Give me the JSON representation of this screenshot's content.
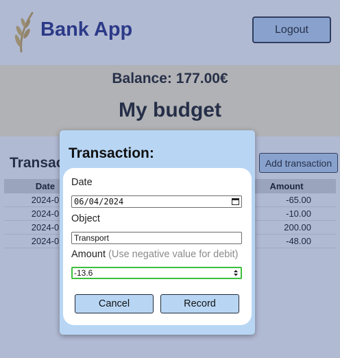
{
  "header": {
    "app_title": "Bank App",
    "logout_label": "Logout",
    "logo_icon": "wheat-logo-icon"
  },
  "summary": {
    "balance": "Balance: 177.00€",
    "budget_title": "My budget"
  },
  "transactions": {
    "title": "Transactions",
    "add_label": "Add transaction",
    "columns": {
      "date": "Date",
      "object": "",
      "amount": "Amount"
    },
    "rows": [
      {
        "date": "2024-0",
        "object": "",
        "amount": "-65.00"
      },
      {
        "date": "2024-0",
        "object": "",
        "amount": "-10.00"
      },
      {
        "date": "2024-0",
        "object": "",
        "amount": "200.00"
      },
      {
        "date": "2024-0",
        "object": "",
        "amount": "-48.00"
      }
    ]
  },
  "modal": {
    "title": "Transaction:",
    "date_label": "Date",
    "date_value": "06/04/2024",
    "object_label": "Object",
    "object_value": "Transport",
    "amount_label": "Amount",
    "amount_hint": "(Use negative value for debit)",
    "amount_value": "-13.6",
    "cancel_label": "Cancel",
    "record_label": "Record"
  },
  "colors": {
    "accent": "#b8d6f4",
    "title_navy": "#1a237e",
    "summary_bg": "#fff2cc",
    "focus_green": "#3cbf3c"
  }
}
